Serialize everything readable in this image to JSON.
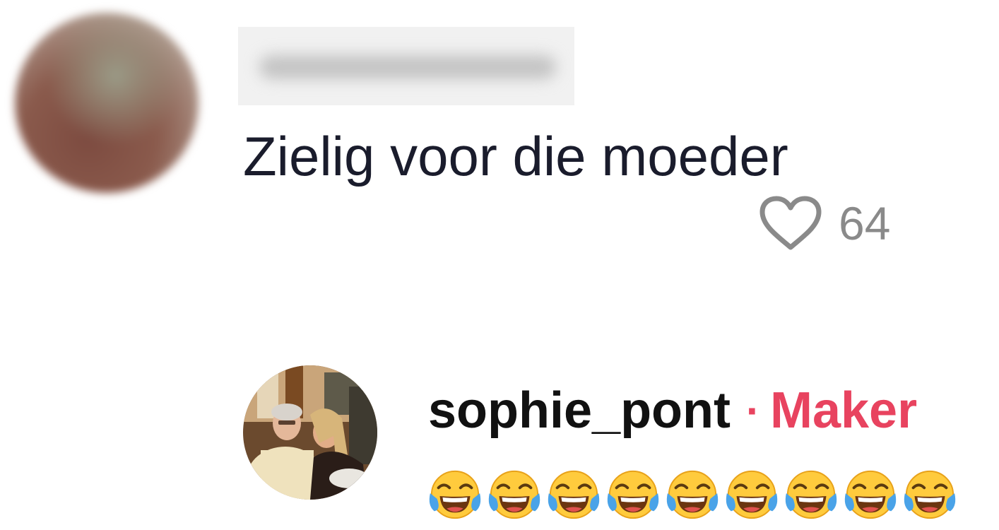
{
  "comment": {
    "text": "Zielig voor die moeder",
    "like_count": "64",
    "like_icon": "heart-outline-icon"
  },
  "reply": {
    "username": "sophie_pont",
    "separator": "·",
    "badge": "Maker",
    "emoji_name": "face-with-tears-of-joy",
    "emoji_count": 9
  },
  "colors": {
    "text": "#1a1c2c",
    "muted": "#8a8a8a",
    "maker": "#e8435f"
  }
}
